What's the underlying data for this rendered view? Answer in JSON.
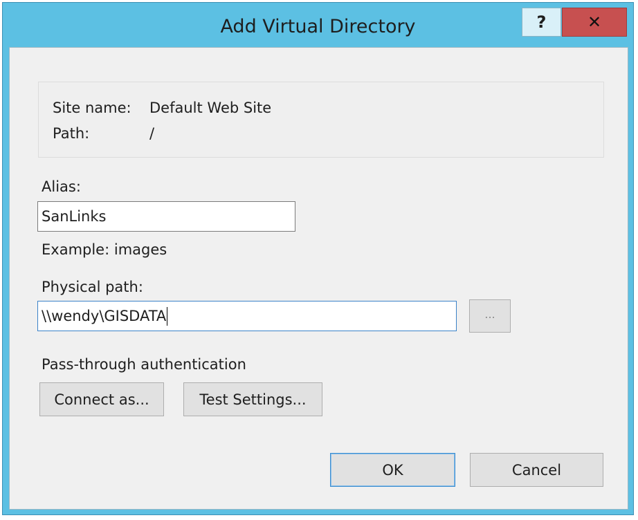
{
  "window": {
    "title": "Add Virtual Directory",
    "help_label": "?",
    "close_label": "✕"
  },
  "info": {
    "site_name_label": "Site name:",
    "site_name_value": "Default Web Site",
    "path_label": "Path:",
    "path_value": "/"
  },
  "alias": {
    "label": "Alias:",
    "value": "SanLinks",
    "example": "Example: images"
  },
  "physical_path": {
    "label": "Physical path:",
    "value": "\\\\wendy\\GISDATA",
    "browse_label": "..."
  },
  "auth": {
    "label": "Pass-through authentication",
    "connect_as_label": "Connect as...",
    "test_settings_label": "Test Settings..."
  },
  "footer": {
    "ok_label": "OK",
    "cancel_label": "Cancel"
  }
}
